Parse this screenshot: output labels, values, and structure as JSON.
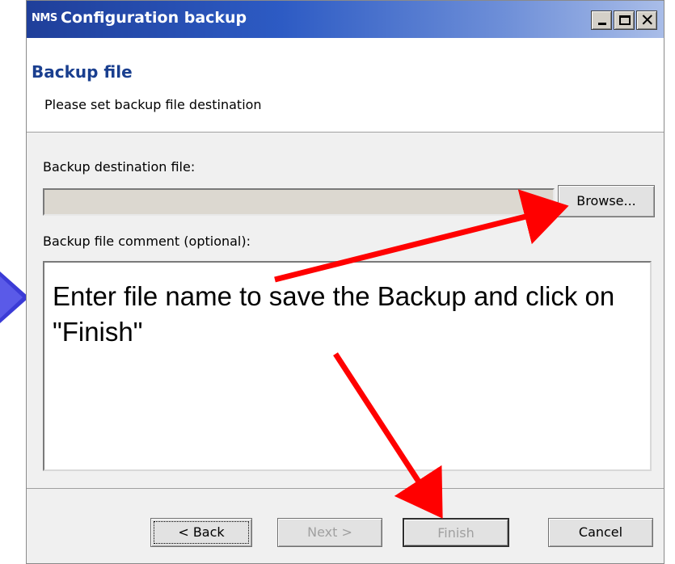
{
  "window": {
    "app_icon_text": "NMS",
    "title": "Configuration backup"
  },
  "header": {
    "title": "Backup file",
    "subtitle": "Please set backup file destination"
  },
  "form": {
    "destination_label": "Backup destination file:",
    "destination_value": "",
    "browse_label": "Browse...",
    "comment_label": "Backup file comment (optional):",
    "comment_value": "Enter file name to save the Backup and click on \"Finish\""
  },
  "footer": {
    "back_label": "< Back",
    "next_label": "Next >",
    "finish_label": "Finish",
    "cancel_label": "Cancel"
  },
  "annotation": {
    "arrow_color": "#ff0000",
    "side_arrow_color": "#3b3bd6"
  },
  "icons": {
    "minimize": "minimize-icon",
    "maximize": "maximize-icon",
    "close": "close-icon"
  }
}
